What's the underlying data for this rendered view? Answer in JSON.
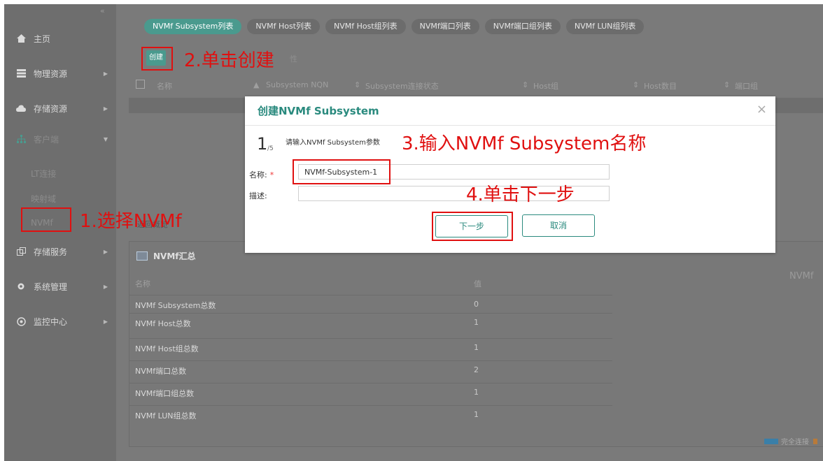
{
  "sidebar": {
    "collapse_icon": "«",
    "items": [
      {
        "label": "主页",
        "icon": "home-icon",
        "has_arrow": false
      },
      {
        "label": "物理资源",
        "icon": "server-icon",
        "has_arrow": true
      },
      {
        "label": "存储资源",
        "icon": "cloud-icon",
        "has_arrow": true
      },
      {
        "label": "客户端",
        "icon": "network-icon",
        "has_arrow": true
      },
      {
        "label": "存储服务",
        "icon": "copy-icon",
        "has_arrow": true
      },
      {
        "label": "系统管理",
        "icon": "gear-icon",
        "has_arrow": true
      },
      {
        "label": "监控中心",
        "icon": "monitor-icon",
        "has_arrow": true
      }
    ],
    "sub_items": [
      "LT连接",
      "映射域",
      "NVMf"
    ]
  },
  "tabs": [
    {
      "label": "NVMf Subsystem列表",
      "active": true
    },
    {
      "label": "NVMf Host列表",
      "active": false
    },
    {
      "label": "NVMf Host组列表",
      "active": false
    },
    {
      "label": "NVMf端口列表",
      "active": false
    },
    {
      "label": "NVMf端口组列表",
      "active": false
    },
    {
      "label": "NVMf LUN组列表",
      "active": false
    }
  ],
  "toolbar": {
    "create_label": "创建",
    "more_label": "性"
  },
  "table": {
    "columns": [
      "名称",
      "Subsystem NQN",
      "Subsystem连接状态",
      "Host组",
      "Host数目",
      "端口组"
    ]
  },
  "overview_link": "返回概览",
  "summary": {
    "title": "NVMf汇总",
    "col_name": "名称",
    "col_value": "值",
    "rows": [
      {
        "name": "NVMf Subsystem总数",
        "value": "0"
      },
      {
        "name": "NVMf Host总数",
        "value": "1"
      },
      {
        "name": "NVMf Host组总数",
        "value": "1"
      },
      {
        "name": "NVMf端口总数",
        "value": "2"
      },
      {
        "name": "NVMf端口组总数",
        "value": "1"
      },
      {
        "name": "NVMf LUN组总数",
        "value": "1"
      }
    ],
    "right_label": "NVMf",
    "legend_label": "完全连接"
  },
  "modal": {
    "title": "创建NVMf Subsystem",
    "close_icon": "×",
    "step_current": "1",
    "step_total": "/5",
    "hint": "请输入NVMf Subsystem参数",
    "name_label": "名称:",
    "required_mark": "*",
    "name_value": "NVMf-Subsystem-1",
    "desc_label": "描述:",
    "desc_value": "",
    "next_label": "下一步",
    "cancel_label": "取消"
  },
  "annotations": {
    "step1": "1.选择NVMf",
    "step2": "2.单击创建",
    "step3": "3.输入NVMf Subsystem名称",
    "step4": "4.单击下一步"
  },
  "colors": {
    "accent": "#2a8a7e",
    "annotation": "#e01010",
    "sidebar": "#6e6e6e"
  }
}
